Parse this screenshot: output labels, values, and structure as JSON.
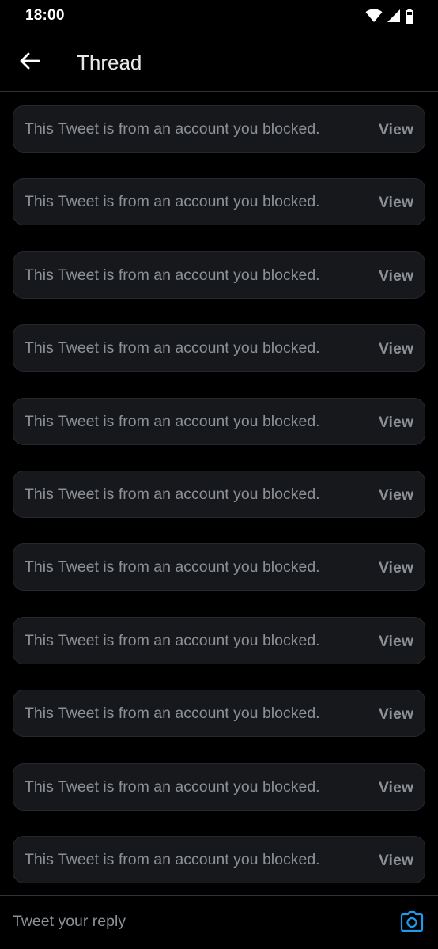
{
  "status_bar": {
    "time": "18:00",
    "icons": [
      "wifi-icon",
      "cell-signal-icon",
      "battery-icon"
    ]
  },
  "header": {
    "back_icon": "arrow-left-icon",
    "title": "Thread"
  },
  "thread": {
    "items": [
      {
        "text": "This Tweet is from an account you blocked.",
        "action": "View"
      },
      {
        "text": "This Tweet is from an account you blocked.",
        "action": "View"
      },
      {
        "text": "This Tweet is from an account you blocked.",
        "action": "View"
      },
      {
        "text": "This Tweet is from an account you blocked.",
        "action": "View"
      },
      {
        "text": "This Tweet is from an account you blocked.",
        "action": "View"
      },
      {
        "text": "This Tweet is from an account you blocked.",
        "action": "View"
      },
      {
        "text": "This Tweet is from an account you blocked.",
        "action": "View"
      },
      {
        "text": "This Tweet is from an account you blocked.",
        "action": "View"
      },
      {
        "text": "This Tweet is from an account you blocked.",
        "action": "View"
      },
      {
        "text": "This Tweet is from an account you blocked.",
        "action": "View"
      },
      {
        "text": "This Tweet is from an account you blocked.",
        "action": "View"
      }
    ]
  },
  "reply_bar": {
    "placeholder": "Tweet your reply",
    "value": "",
    "camera_icon": "camera-icon"
  },
  "colors": {
    "background": "#000000",
    "card_background": "#16181c",
    "card_border": "#25282c",
    "muted_text": "#8b9197",
    "primary_text": "#e7e9ea",
    "accent": "#1d9bf0"
  }
}
